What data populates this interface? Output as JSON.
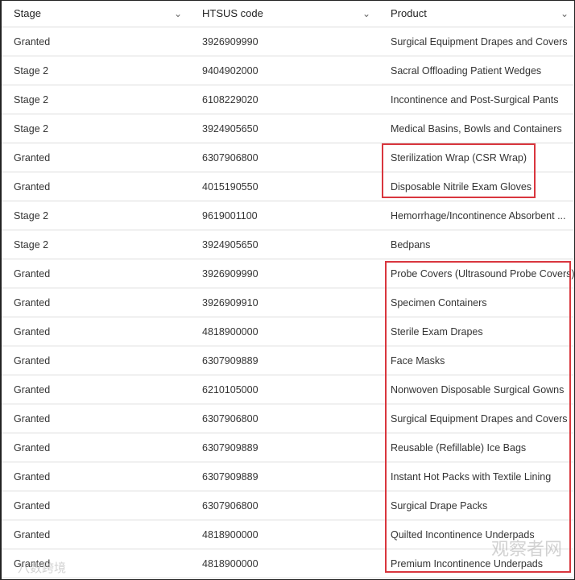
{
  "columns": [
    "Stage",
    "HTSUS code",
    "Product"
  ],
  "rows": [
    [
      "Granted",
      "3926909990",
      "Surgical Equipment Drapes and Covers"
    ],
    [
      "Stage 2",
      "9404902000",
      "Sacral Offloading Patient Wedges"
    ],
    [
      "Stage 2",
      "6108229020",
      "Incontinence and Post-Surgical Pants"
    ],
    [
      "Stage 2",
      "3924905650",
      "Medical Basins, Bowls and Containers"
    ],
    [
      "Granted",
      "6307906800",
      "Sterilization Wrap (CSR Wrap)"
    ],
    [
      "Granted",
      "4015190550",
      "Disposable Nitrile Exam Gloves"
    ],
    [
      "Stage 2",
      "9619001100",
      "Hemorrhage/Incontinence Absorbent ..."
    ],
    [
      "Stage 2",
      "3924905650",
      "Bedpans"
    ],
    [
      "Granted",
      "3926909990",
      "Probe Covers (Ultrasound Probe Covers)"
    ],
    [
      "Granted",
      "3926909910",
      "Specimen Containers"
    ],
    [
      "Granted",
      "4818900000",
      "Sterile Exam Drapes"
    ],
    [
      "Granted",
      "6307909889",
      "Face Masks"
    ],
    [
      "Granted",
      "6210105000",
      "Nonwoven Disposable Surgical Gowns"
    ],
    [
      "Granted",
      "6307906800",
      "Surgical Equipment Drapes and Covers"
    ],
    [
      "Granted",
      "6307909889",
      "Reusable (Refillable) Ice Bags"
    ],
    [
      "Granted",
      "6307909889",
      "Instant Hot Packs with Textile Lining"
    ],
    [
      "Granted",
      "6307906800",
      "Surgical Drape Packs"
    ],
    [
      "Granted",
      "4818900000",
      "Quilted Incontinence Underpads"
    ],
    [
      "Granted",
      "4818900000",
      "Premium Incontinence Underpads"
    ]
  ],
  "watermarks": [
    "观察者网",
    "八数跨境"
  ],
  "highlight_color": "#d9363e"
}
